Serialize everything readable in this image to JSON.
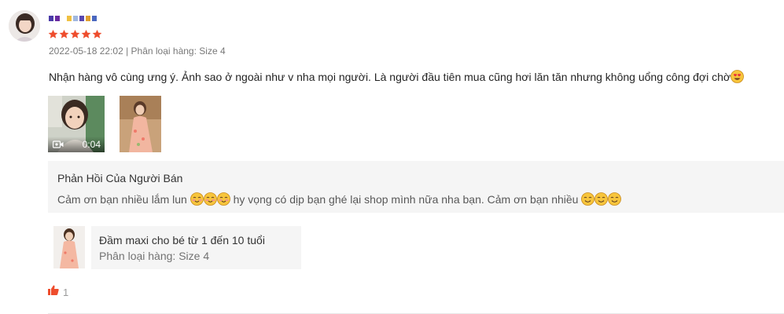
{
  "review": {
    "timestamp_variation": "2022-05-18 22:02 | Phân loại hàng: Size 4",
    "rating": 5,
    "content": "Nhận hàng vô cùng ưng ý. Ảnh sao ở ngoài như v nha mọi người. Là người đầu tiên mua cũng hơi lăn tăn nhưng không uổng công đợi chờ",
    "video_duration": "0:04",
    "username_colors": [
      "#4a3aa8",
      "#6a2aa0",
      "#f0c040",
      "#a0b8e0",
      "#5a48b0",
      "#e0a030",
      "#4a68c0"
    ]
  },
  "seller_reply": {
    "title": "Phản Hồi Của Người Bán",
    "text_part1": "Cảm ơn bạn nhiều lắm lun",
    "text_part2": "hy vọng có dịp bạn ghé lại shop mình nữa nha bạn. Cảm ơn bạn nhiều"
  },
  "product": {
    "name": "Đầm maxi cho bé từ 1 đến 10 tuổi",
    "variation": "Phân loại hàng: Size 4"
  },
  "likes": {
    "count": "1"
  },
  "colors": {
    "star": "#ee4d2d",
    "like": "#ee4d2d",
    "panel": "#f5f5f5"
  }
}
